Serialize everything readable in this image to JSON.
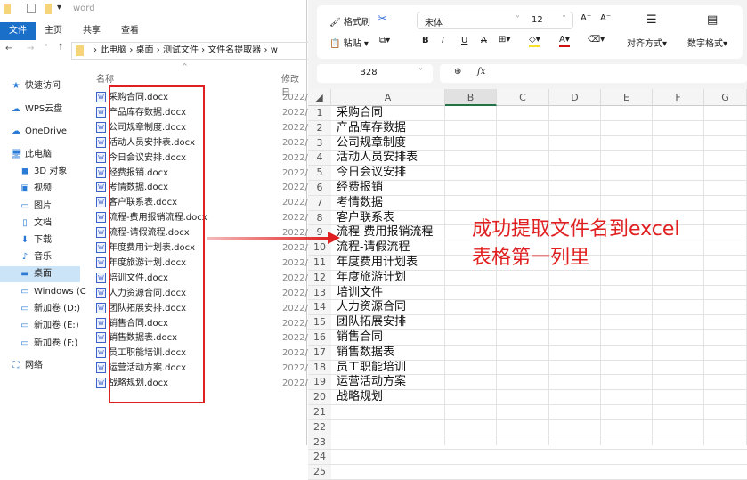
{
  "explorer": {
    "title": "word",
    "tabs": [
      "文件",
      "主页",
      "共享",
      "查看"
    ],
    "breadcrumb": [
      "此电脑",
      "桌面",
      "测试文件",
      "文件名提取器",
      "w"
    ],
    "col_name": "名称",
    "col_date": "修改日",
    "sidebar": [
      {
        "label": "快速访问",
        "icon": "star-icon"
      },
      {
        "label": "WPS云盘",
        "icon": "cloud-icon"
      },
      {
        "label": "OneDrive",
        "icon": "cloud-icon"
      },
      {
        "label": "此电脑",
        "icon": "computer-icon"
      },
      {
        "label": "3D 对象",
        "icon": "cube-icon"
      },
      {
        "label": "视频",
        "icon": "video-icon"
      },
      {
        "label": "图片",
        "icon": "picture-icon"
      },
      {
        "label": "文档",
        "icon": "document-icon"
      },
      {
        "label": "下载",
        "icon": "download-icon"
      },
      {
        "label": "音乐",
        "icon": "music-icon"
      },
      {
        "label": "桌面",
        "icon": "desktop-icon",
        "selected": true
      },
      {
        "label": "Windows (C",
        "icon": "drive-icon"
      },
      {
        "label": "新加卷 (D:)",
        "icon": "drive-icon"
      },
      {
        "label": "新加卷 (E:)",
        "icon": "drive-icon"
      },
      {
        "label": "新加卷 (F:)",
        "icon": "drive-icon"
      },
      {
        "label": "网络",
        "icon": "network-icon"
      }
    ],
    "files": [
      "采购合同.docx",
      "产品库存数据.docx",
      "公司规章制度.docx",
      "活动人员安排表.docx",
      "今日会议安排.docx",
      "经费报销.docx",
      "考情数据.docx",
      "客户联系表.docx",
      "流程-费用报销流程.docx",
      "流程-请假流程.docx",
      "年度费用计划表.docx",
      "年度旅游计划.docx",
      "培训文件.docx",
      "人力资源合同.docx",
      "团队拓展安排.docx",
      "销售合同.docx",
      "销售数据表.docx",
      "员工职能培训.docx",
      "运营活动方案.docx",
      "战略规划.docx"
    ],
    "date_prefix": "2022/"
  },
  "excel": {
    "format_painter": "格式刷",
    "paste": "粘贴",
    "font": "宋体",
    "font_size": "12",
    "align": "对齐方式",
    "number_format": "数字格式",
    "name_box": "B28",
    "fx": "fx",
    "columns": [
      "A",
      "B",
      "C",
      "D",
      "E",
      "F",
      "G"
    ],
    "selected_column": "B",
    "rows": [
      "采购合同",
      "产品库存数据",
      "公司规章制度",
      "活动人员安排表",
      "今日会议安排",
      "经费报销",
      "考情数据",
      "客户联系表",
      "流程-费用报销流程",
      "流程-请假流程",
      "年度费用计划表",
      "年度旅游计划",
      "培训文件",
      "人力资源合同",
      "团队拓展安排",
      "销售合同",
      "销售数据表",
      "员工职能培训",
      "运营活动方案",
      "战略规划"
    ],
    "row_count": 25
  },
  "annotation": {
    "line1": "成功提取文件名到excel",
    "line2": "表格第一列里",
    "color": "#e02020"
  }
}
